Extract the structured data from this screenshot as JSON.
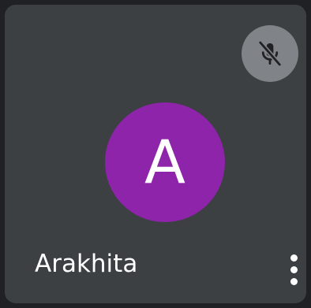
{
  "participant": {
    "name": "Arakhita",
    "initial": "A",
    "avatar_color": "#8e24aa",
    "muted": true
  },
  "icons": {
    "mute": "mic-off-icon",
    "more": "more-vert-icon"
  },
  "colors": {
    "tile_background": "#3c4043",
    "page_background": "#202124",
    "mute_badge": "#808488"
  }
}
